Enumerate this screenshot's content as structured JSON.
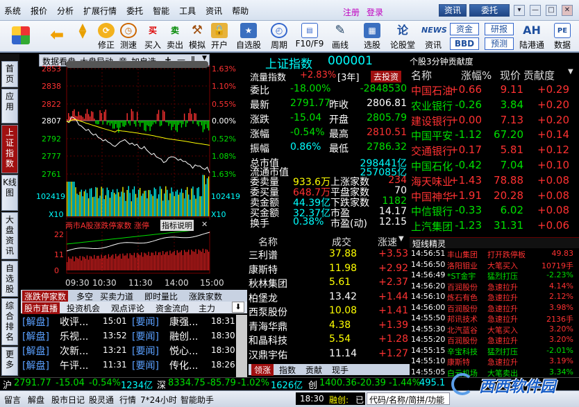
{
  "menu": [
    "系统",
    "报价",
    "分析",
    "扩展行情",
    "委托",
    "智能",
    "工具",
    "资讯",
    "帮助"
  ],
  "title_links": {
    "register": "注册",
    "login": "登录",
    "news": "资讯",
    "trade": "委托"
  },
  "window_buttons": [
    "▾",
    "—",
    "□",
    "✕"
  ],
  "toolbar": [
    {
      "label": "",
      "icon": "app-grid-icon"
    },
    {
      "label": "",
      "icon": "back-arrow-icon"
    },
    {
      "label": "",
      "icon": "up-down-arrows-icon"
    },
    {
      "label": "修正",
      "icon": "fix-icon"
    },
    {
      "label": "测速",
      "icon": "clock-icon"
    },
    {
      "label": "买入",
      "icon": "buy-icon",
      "glyph": "买"
    },
    {
      "label": "卖出",
      "icon": "sell-icon",
      "glyph": "卖"
    },
    {
      "label": "模拟",
      "icon": "hammer-icon"
    },
    {
      "label": "开户",
      "icon": "lock-icon"
    },
    {
      "label": "自选股",
      "icon": "star-folder-icon"
    },
    {
      "label": "周期",
      "icon": "cycle-icon"
    },
    {
      "label": "F10/F9",
      "icon": "f10-icon"
    },
    {
      "label": "画线",
      "icon": "pencil-icon"
    },
    {
      "label": "选股",
      "icon": "select-stock-icon"
    },
    {
      "label": "论股堂",
      "icon": "forum-icon",
      "glyph": "论"
    },
    {
      "label": "资讯",
      "icon": "news-icon",
      "glyph": "NEWS"
    },
    {
      "label": "资金",
      "icon": "fund-icon"
    },
    {
      "label": "BBD",
      "icon": "bbd-icon"
    },
    {
      "label": "研报",
      "icon": "report-icon"
    },
    {
      "label": "预测",
      "icon": "forecast-icon"
    },
    {
      "label": "陆港通",
      "icon": "ah-icon",
      "glyph": "AH"
    },
    {
      "label": "数据",
      "icon": "pe-icon",
      "glyph": "PE"
    }
  ],
  "left_tabs": [
    "首页",
    "应用",
    "上证指数",
    "K线图",
    "大盘资讯",
    "自选股",
    "综合排名",
    "更多"
  ],
  "chart_toolbar": {
    "items": [
      "数据看盘",
      "大盘异动",
      "竞",
      "加自选"
    ],
    "ops": [
      "+",
      "—",
      "Ⅱ"
    ]
  },
  "chart_data": [
    {
      "type": "line",
      "y_ticks_left": [
        "2853",
        "2838",
        "2822",
        "2807",
        "2792",
        "2777",
        "2761"
      ],
      "y_ticks_right": [
        "1.63%",
        "1.10%",
        "0.55%",
        "0.00%",
        "0.52%",
        "1.08%",
        "1.63%"
      ],
      "volume_labels": [
        "102419",
        "X10"
      ],
      "x_labels": [
        "09:30",
        "10:30",
        "11:30",
        "14:00",
        "15:00"
      ],
      "price_series": [
        2807,
        2806,
        2811,
        2810,
        2808,
        2804,
        2803,
        2801,
        2799,
        2800,
        2797,
        2795,
        2796,
        2793,
        2792,
        2790,
        2791,
        2789,
        2788,
        2786,
        2785,
        2787,
        2789,
        2790,
        2791,
        2789,
        2787,
        2788,
        2786,
        2787,
        2784,
        2783,
        2785,
        2782,
        2780,
        2778,
        2779,
        2776,
        2775,
        2774,
        2771,
        2772,
        2775,
        2776,
        2776,
        2775,
        2773,
        2774,
        2772,
        2772,
        2770,
        2769,
        2766,
        2769,
        2768,
        2768,
        2766,
        2765,
        2767,
        2762
      ]
    },
    {
      "type": "line",
      "title": "两市A股涨跌停家数",
      "sub": "涨停",
      "link": "指标说明",
      "y_ticks": [
        "22",
        "11",
        "0"
      ]
    }
  ],
  "index_header": {
    "name": "上证指数",
    "code": "000001"
  },
  "quote": {
    "row0": {
      "l": "流量指数",
      "v": "+2.83%",
      "tag": "[3年]",
      "btn": "去投资"
    },
    "rows": [
      {
        "k1": "委比",
        "v1": "-18.00%",
        "k2": "",
        "v2": "-2848530"
      },
      {
        "k1": "最新",
        "v1": "2791.77",
        "k2": "昨收",
        "v2": "2806.81"
      },
      {
        "k1": "涨跌",
        "v1": "-15.04",
        "k2": "开盘",
        "v2": "2805.79"
      },
      {
        "k1": "涨幅",
        "v1": "-0.54%",
        "k2": "最高",
        "v2": "2810.51"
      },
      {
        "k1": "振幅",
        "v1": "0.86%",
        "k2": "最低",
        "v2": "2786.32"
      }
    ],
    "mkt": [
      {
        "k": "总市值",
        "v": "298441亿"
      },
      {
        "k": "流通市值",
        "v": "257085亿"
      }
    ],
    "vol": [
      {
        "k1": "委卖量",
        "v1": "933.6万",
        "k2": "上涨家数",
        "v2": "234"
      },
      {
        "k1": "委买量",
        "v1": "648.7万",
        "k2": "平盘家数",
        "v2": "70"
      },
      {
        "k1": "卖金额",
        "v1": "44.39亿",
        "k2": "下跌家数",
        "v2": "1182"
      },
      {
        "k1": "买金额",
        "v1": "32.37亿",
        "k2": "市盈",
        "v2": "14.17"
      },
      {
        "k1": "换手",
        "v1": "0.38%",
        "k2": "市盈(动)",
        "v2": "12.15"
      }
    ]
  },
  "rank_table": {
    "headers": [
      "名称",
      "成交",
      "涨速"
    ],
    "rows": [
      [
        "三利谱",
        "37.88",
        "+3.53"
      ],
      [
        "康斯特",
        "11.98",
        "+2.92"
      ],
      [
        "秋林集团",
        "5.61",
        "+2.37"
      ],
      [
        "柏堡龙",
        "13.42",
        "+1.44"
      ],
      [
        "西泵股份",
        "10.08",
        "+1.41"
      ],
      [
        "青海华鼎",
        "4.38",
        "+1.39"
      ],
      [
        "和晶科技",
        "5.54",
        "+1.28"
      ],
      [
        "汉鼎宇佑",
        "11.14",
        "+1.27"
      ]
    ],
    "tabs": [
      "领涨",
      "指数",
      "贡献",
      "现手"
    ]
  },
  "contrib": {
    "title": "个股3分钟贡献度",
    "headers": [
      "名称",
      "涨幅%",
      "现价",
      "贡献度"
    ],
    "rows": [
      [
        "中国石油",
        "+0.66",
        "9.11",
        "+0.29"
      ],
      [
        "农业银行",
        "-0.26",
        "3.84",
        "+0.20"
      ],
      [
        "建设银行",
        "+0.00",
        "7.13",
        "+0.20"
      ],
      [
        "中国平安",
        "-1.12",
        "67.20",
        "+0.14"
      ],
      [
        "交通银行",
        "+0.17",
        "5.81",
        "+0.12"
      ],
      [
        "中国石化",
        "-0.42",
        "7.04",
        "+0.10"
      ],
      [
        "海天味业",
        "+1.43",
        "78.88",
        "+0.08"
      ],
      [
        "中国神华",
        "+1.91",
        "20.28",
        "+0.08"
      ],
      [
        "中信银行",
        "-0.33",
        "6.02",
        "+0.08"
      ],
      [
        "上汽集团",
        "-1.23",
        "31.31",
        "+0.06"
      ]
    ]
  },
  "sprite": {
    "title": "短线精灵",
    "rows": [
      [
        "14:56:51",
        "丰山集团",
        "打开跌停板",
        "49.83"
      ],
      [
        "14:56:50",
        "洛阳钼业",
        "大笔买入",
        "10719手"
      ],
      [
        "14:56:49",
        "*ST金宇",
        "猛烈打压",
        "-2.23%"
      ],
      [
        "14:56:20",
        "百润股份",
        "急速拉升",
        "4.14%"
      ],
      [
        "14:56:10",
        "炼石有色",
        "急速拉升",
        "2.12%"
      ],
      [
        "14:56:00",
        "百润股份",
        "急速拉升",
        "3.98%"
      ],
      [
        "14:55:50",
        "邦讯技术",
        "急速拉升",
        "2136手"
      ],
      [
        "14:55:30",
        "北汽蓝谷",
        "大笔买入",
        "3.20%"
      ],
      [
        "14:55:20",
        "百润股份",
        "急速拉升",
        "3.20%"
      ],
      [
        "14:55:15",
        "辛宝科技",
        "猛烈打压",
        "-2.01%"
      ],
      [
        "14:55:10",
        "康斯特",
        "急速拉升",
        "3.19%"
      ],
      [
        "14:55:05",
        "白云机场",
        "大笔卖出",
        "3.34%"
      ]
    ]
  },
  "stat_tabs": [
    "涨跌停家数",
    "多空",
    "买卖力道",
    "即时量比",
    "涨跌家数"
  ],
  "news_tabs": [
    "股市直播",
    "投资机会",
    "观点评论",
    "资金流向",
    "主力"
  ],
  "news": [
    [
      "[解盘]",
      "收评...",
      "15:01",
      "[要闻]",
      "康强...",
      "18:31"
    ],
    [
      "[解盘]",
      "乐视...",
      "13:52",
      "[要闻]",
      "融创...",
      "18:30"
    ],
    [
      "[解盘]",
      "次新...",
      "13:21",
      "[要闻]",
      "悦心...",
      "18:30"
    ],
    [
      "[解盘]",
      "午评...",
      "11:31",
      "[要闻]",
      "传化...",
      "18:26"
    ]
  ],
  "ticker": {
    "sh": "沪",
    "sh_v": "2791.77",
    "sh_c": "-15.04",
    "sh_p": "-0.54%",
    "sh_a": "1234亿",
    "sz": "深",
    "sz_v": "8334.75",
    "sz_c": "-85.79",
    "sz_p": "-1.02%",
    "sz_a": "1626亿",
    "cy": "创",
    "cy_v": "1400.36",
    "cy_c": "-20.39",
    "cy_p": "-1.44%",
    "cy_a": "495.1"
  },
  "status": {
    "items": [
      "留言",
      "解盘",
      "股市日记",
      "股灵通",
      "行情",
      "7*24小时",
      "智能助手"
    ],
    "time": "18:30",
    "r1": "融创:",
    "r2": "已",
    "search": "代码/名称/简拼/功能"
  },
  "watermark": "西西软件园"
}
